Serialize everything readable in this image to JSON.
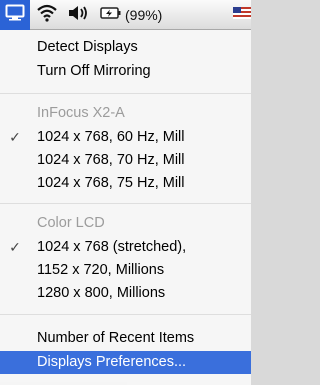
{
  "menubar": {
    "items": [
      {
        "icon": "displays-icon"
      },
      {
        "icon": "wifi-icon"
      },
      {
        "icon": "volume-icon"
      },
      {
        "icon": "battery-icon"
      },
      {
        "icon": "flag-icon"
      }
    ],
    "battery_percent": "(99%)"
  },
  "menu": {
    "items": [
      {
        "label": "Detect Displays"
      },
      {
        "label": "Turn Off Mirroring"
      },
      {
        "label": "InFocus X2-A"
      },
      {
        "label": "1024 x 768, 60 Hz, Mill",
        "check": "✓"
      },
      {
        "label": "1024 x 768, 70 Hz, Mill"
      },
      {
        "label": "1024 x 768, 75 Hz, Mill"
      },
      {
        "label": "Color LCD"
      },
      {
        "label": "1024 x 768 (stretched),",
        "check": "✓"
      },
      {
        "label": "1152 x 720, Millions"
      },
      {
        "label": "1280 x 800, Millions"
      },
      {
        "label": "Number of Recent Items"
      },
      {
        "label": "Displays Preferences..."
      }
    ]
  },
  "colors": {
    "highlight": "#3a6fdc",
    "menubar_accent": "#2b63d6",
    "disabled_text": "#9c9c9c"
  }
}
